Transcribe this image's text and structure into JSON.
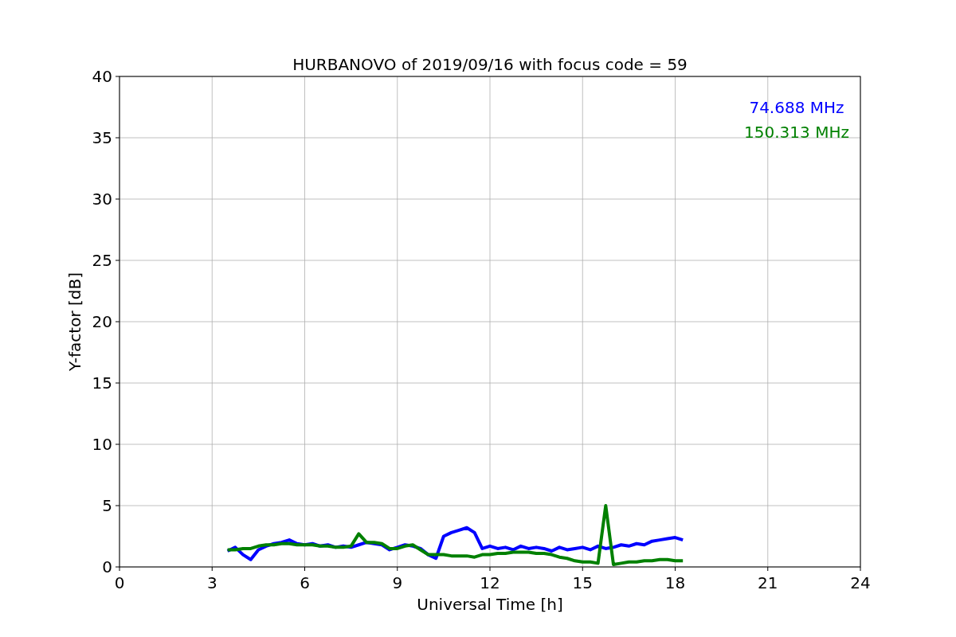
{
  "chart_data": {
    "type": "line",
    "title": "HURBANOVO of 2019/09/16 with focus code = 59",
    "xlabel": "Universal Time [h]",
    "ylabel": "Y-factor [dB]",
    "x": [
      3.5,
      3.75,
      4,
      4.25,
      4.5,
      4.75,
      5,
      5.25,
      5.5,
      5.75,
      6,
      6.25,
      6.5,
      6.75,
      7,
      7.25,
      7.5,
      7.75,
      8,
      8.25,
      8.5,
      8.75,
      9,
      9.25,
      9.5,
      9.75,
      10,
      10.25,
      10.5,
      10.75,
      11,
      11.25,
      11.5,
      11.75,
      12,
      12.25,
      12.5,
      12.75,
      13,
      13.25,
      13.5,
      13.75,
      14,
      14.25,
      14.5,
      14.75,
      15,
      15.25,
      15.5,
      15.75,
      16,
      16.25,
      16.5,
      16.75,
      17,
      17.25,
      17.5,
      17.75,
      18,
      18.25
    ],
    "series": [
      {
        "name": "74.688 MHz",
        "color": "#0000ff",
        "values": [
          1.3,
          1.6,
          1.0,
          0.6,
          1.4,
          1.7,
          1.9,
          2.0,
          2.2,
          1.9,
          1.8,
          1.9,
          1.7,
          1.8,
          1.6,
          1.7,
          1.6,
          1.8,
          2.0,
          1.9,
          1.8,
          1.4,
          1.6,
          1.8,
          1.7,
          1.5,
          1.0,
          0.7,
          2.5,
          2.8,
          3.0,
          3.2,
          2.8,
          1.5,
          1.7,
          1.5,
          1.6,
          1.4,
          1.7,
          1.5,
          1.6,
          1.5,
          1.3,
          1.6,
          1.4,
          1.5,
          1.6,
          1.4,
          1.7,
          1.5,
          1.6,
          1.8,
          1.7,
          1.9,
          1.8,
          2.1,
          2.2,
          2.3,
          2.4,
          2.2
        ]
      },
      {
        "name": "150.313 MHz",
        "color": "#008000",
        "values": [
          1.4,
          1.4,
          1.5,
          1.5,
          1.7,
          1.8,
          1.8,
          1.9,
          1.9,
          1.8,
          1.8,
          1.8,
          1.7,
          1.7,
          1.6,
          1.6,
          1.7,
          2.7,
          2.0,
          2.0,
          1.9,
          1.5,
          1.5,
          1.7,
          1.8,
          1.4,
          1.0,
          1.0,
          1.0,
          0.9,
          0.9,
          0.9,
          0.8,
          1.0,
          1.0,
          1.1,
          1.1,
          1.2,
          1.2,
          1.2,
          1.1,
          1.1,
          1.0,
          0.8,
          0.7,
          0.5,
          0.4,
          0.4,
          0.3,
          5.0,
          0.2,
          0.3,
          0.4,
          0.4,
          0.5,
          0.5,
          0.6,
          0.6,
          0.5,
          0.5
        ]
      }
    ],
    "xlim": [
      0,
      24
    ],
    "ylim": [
      0,
      40
    ],
    "xticks": [
      0,
      3,
      6,
      9,
      12,
      15,
      18,
      21,
      24
    ],
    "yticks": [
      0,
      5,
      10,
      15,
      20,
      25,
      30,
      35,
      40
    ],
    "grid": true
  }
}
